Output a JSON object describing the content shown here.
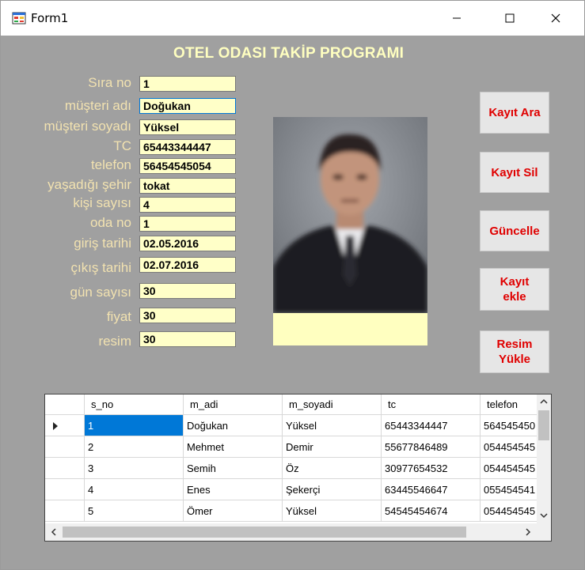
{
  "window": {
    "title": "Form1",
    "controls": {
      "minimize": "minimize-icon",
      "maximize": "maximize-icon",
      "close": "close-icon"
    }
  },
  "form": {
    "heading": "OTEL ODASI TAKİP PROGRAMI",
    "fields": [
      {
        "key": "sira_no",
        "label": "Sıra no",
        "value": "1"
      },
      {
        "key": "musteri_adi",
        "label": "müşteri adı",
        "value": "Doğukan"
      },
      {
        "key": "musteri_soyadi",
        "label": "müşteri soyadı",
        "value": "Yüksel"
      },
      {
        "key": "tc",
        "label": "TC",
        "value": "65443344447"
      },
      {
        "key": "telefon",
        "label": "telefon",
        "value": "56454545054"
      },
      {
        "key": "sehir",
        "label": "yaşadığı şehir",
        "value": "tokat"
      },
      {
        "key": "kisi_sayisi",
        "label": "kişi sayısı",
        "value": "4"
      },
      {
        "key": "oda_no",
        "label": "oda no",
        "value": "1"
      },
      {
        "key": "giris_tarihi",
        "label": "giriş tarihi",
        "value": "02.05.2016"
      },
      {
        "key": "cikis_tarihi",
        "label": "çıkış tarihi",
        "value": "02.07.2016"
      },
      {
        "key": "gun_sayisi",
        "label": "gün sayısı",
        "value": "30"
      },
      {
        "key": "fiyat",
        "label": "fiyat",
        "value": "30"
      },
      {
        "key": "resim",
        "label": "resim",
        "value": "30"
      }
    ]
  },
  "buttons": {
    "kayit_ara": "Kayıt Ara",
    "kayit_sil": "Kayıt Sil",
    "guncelle": "Güncelle",
    "kayit_ekle_1": "Kayıt",
    "kayit_ekle_2": "ekle",
    "resim_yukle_1": "Resim",
    "resim_yukle_2": "Yükle"
  },
  "grid": {
    "columns": [
      "s_no",
      "m_adi",
      "m_soyadi",
      "tc",
      "telefon"
    ],
    "rows": [
      [
        "1",
        "Doğukan",
        "Yüksel",
        "65443344447",
        "564545450"
      ],
      [
        "2",
        "Mehmet",
        "Demir",
        "55677846489",
        "054454545"
      ],
      [
        "3",
        "Semih",
        "Öz",
        "30977654532",
        "054454545"
      ],
      [
        "4",
        "Enes",
        "Şekerçi",
        "63445546647",
        "055454541"
      ],
      [
        "5",
        "Ömer",
        "Yüksel",
        "54545454674",
        "054454545"
      ]
    ],
    "selected_row": 0,
    "colors": {
      "selection": "#0078d7"
    }
  },
  "colors": {
    "form_bg": "#a0a0a0",
    "label": "#f2e2b0",
    "heading": "#ffffc0",
    "textbox_bg": "#ffffc8",
    "button_text": "#e00000"
  }
}
